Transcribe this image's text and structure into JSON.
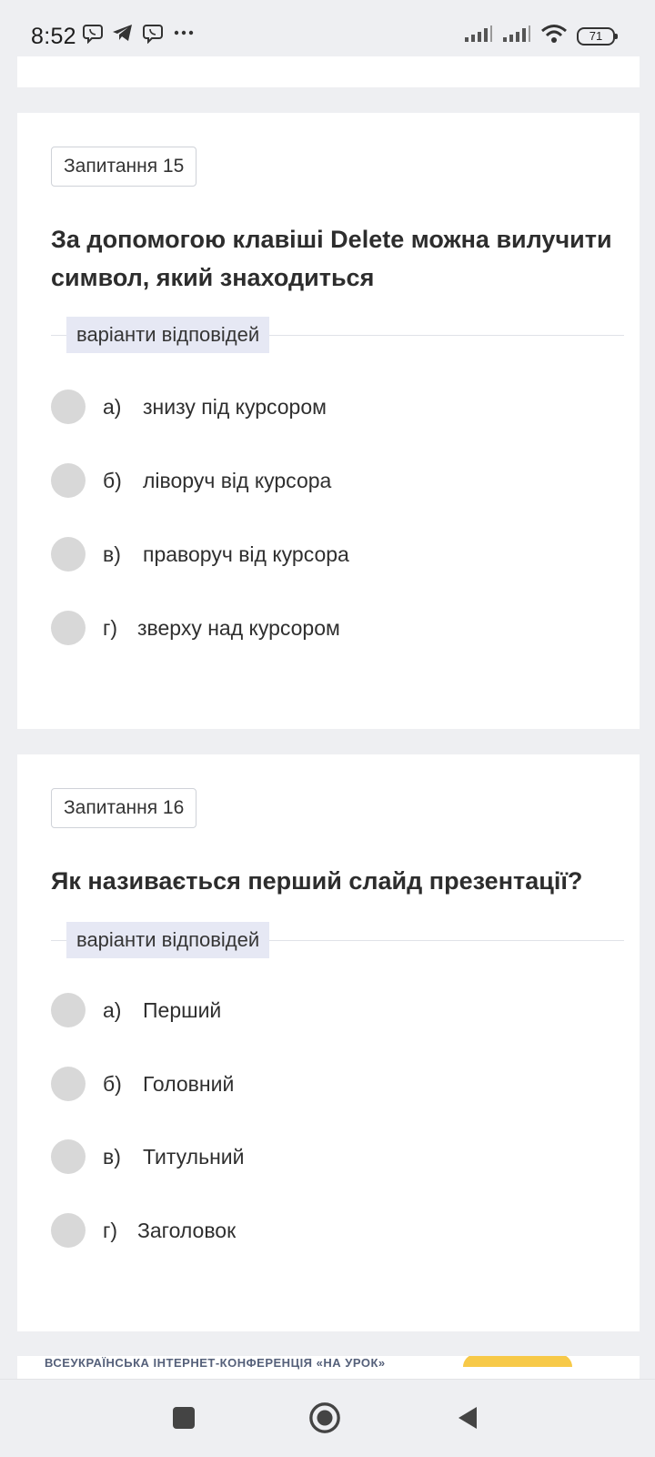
{
  "status_bar": {
    "time": "8:52",
    "battery": "71",
    "left_icons": [
      "viber-icon",
      "telegram-icon",
      "viber-icon",
      "more-dots-icon"
    ],
    "right_icons": [
      "signal-icon",
      "signal-icon",
      "wifi-icon",
      "battery-icon"
    ]
  },
  "questions": [
    {
      "badge": "Запитання 15",
      "text": "За допомогою клавіші Delete можна вилучити символ, який знаходиться",
      "answers_label": "варіанти відповідей",
      "options": [
        {
          "letter": "а)",
          "text": "знизу під курсором"
        },
        {
          "letter": "б)",
          "text": "ліворуч від курсора"
        },
        {
          "letter": "в)",
          "text": "праворуч від курсора"
        },
        {
          "letter": "г)",
          "text": "зверху над курсором"
        }
      ]
    },
    {
      "badge": "Запитання 16",
      "text": "Як називається перший слайд презентації?",
      "answers_label": "варіанти відповідей",
      "options": [
        {
          "letter": "а)",
          "text": "Перший"
        },
        {
          "letter": "б)",
          "text": "Головний"
        },
        {
          "letter": "в)",
          "text": "Титульний"
        },
        {
          "letter": "г)",
          "text": "Заголовок"
        }
      ]
    }
  ],
  "footer_banner": {
    "text": "ВСЕУКРАЇНСЬКА ІНТЕРНЕТ-КОНФЕРЕНЦІЯ «НА УРОК»"
  },
  "nav_bar": {
    "icons": [
      "recents-square-icon",
      "home-circle-icon",
      "back-triangle-icon"
    ]
  }
}
